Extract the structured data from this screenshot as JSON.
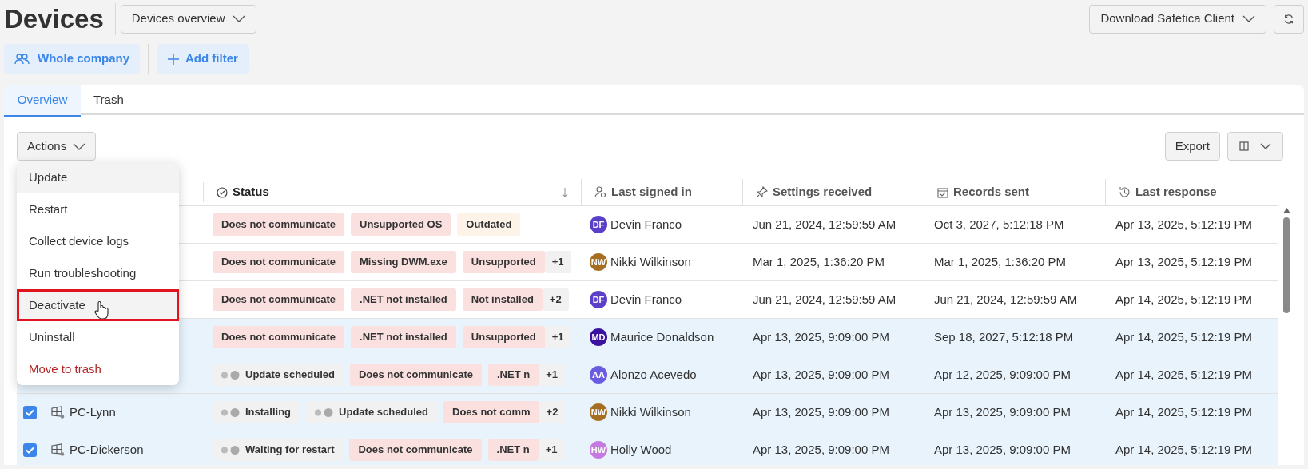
{
  "header": {
    "title": "Devices",
    "view_select": "Devices overview",
    "download_button": "Download Safetica Client"
  },
  "filters": {
    "scope": "Whole company",
    "add_filter": "Add filter"
  },
  "tabs": [
    {
      "label": "Overview",
      "selected": true
    },
    {
      "label": "Trash",
      "selected": false
    }
  ],
  "toolbar": {
    "actions": "Actions",
    "export": "Export"
  },
  "actions_menu": [
    {
      "label": "Update",
      "kind": "normal",
      "hovered": true,
      "outlined": false
    },
    {
      "label": "Restart",
      "kind": "normal",
      "hovered": false,
      "outlined": false
    },
    {
      "label": "Collect device logs",
      "kind": "normal",
      "hovered": false,
      "outlined": false
    },
    {
      "label": "Run troubleshooting",
      "kind": "normal",
      "hovered": false,
      "outlined": false
    },
    {
      "label": "Deactivate",
      "kind": "normal",
      "hovered": true,
      "outlined": true
    },
    {
      "label": "Uninstall",
      "kind": "normal",
      "hovered": false,
      "outlined": false
    },
    {
      "label": "Move to trash",
      "kind": "danger",
      "hovered": false,
      "outlined": false
    }
  ],
  "table": {
    "columns": [
      "Status",
      "Last signed in",
      "Settings received",
      "Records sent",
      "Last response"
    ],
    "rows": [
      {
        "selected": false,
        "status": [
          {
            "label": "Does not communicate",
            "kind": "error"
          },
          {
            "label": "Unsupported OS",
            "kind": "error"
          },
          {
            "label": "Outdated",
            "kind": "warning"
          }
        ],
        "user": {
          "initials": "DF",
          "name": "Devin Franco",
          "color": "#5a3fc8"
        },
        "settings_received": "Jun 21, 2024, 12:59:59 AM",
        "records_sent": "Oct 3, 2027, 5:12:18 PM",
        "last_response": "Apr 13, 2025, 5:12:19 PM"
      },
      {
        "selected": false,
        "status": [
          {
            "label": "Does not communicate",
            "kind": "error"
          },
          {
            "label": "Missing DWM.exe",
            "kind": "error"
          },
          {
            "label": "Unsupported",
            "kind": "error"
          }
        ],
        "more": "+1",
        "user": {
          "initials": "NW",
          "name": "Nikki Wilkinson",
          "color": "#a66e22"
        },
        "settings_received": "Mar 1, 2025, 1:36:20 PM",
        "records_sent": "Mar 1, 2025, 1:36:20 PM",
        "last_response": "Apr 13, 2025, 5:12:19 PM"
      },
      {
        "selected": false,
        "status": [
          {
            "label": "Does not communicate",
            "kind": "error"
          },
          {
            "label": ".NET not installed",
            "kind": "error"
          },
          {
            "label": "Not installed",
            "kind": "error"
          }
        ],
        "more": "+2",
        "user": {
          "initials": "DF",
          "name": "Devin Franco",
          "color": "#5a3fc8"
        },
        "settings_received": "Jun 21, 2024, 12:59:59 AM",
        "records_sent": "Jun 21, 2024, 12:59:59 AM",
        "last_response": "Apr 14, 2025, 5:12:19 PM"
      },
      {
        "selected": true,
        "status": [
          {
            "label": "Does not communicate",
            "kind": "error"
          },
          {
            "label": ".NET not installed",
            "kind": "error"
          },
          {
            "label": "Unsupported",
            "kind": "error"
          }
        ],
        "more": "+1",
        "user": {
          "initials": "MD",
          "name": "Maurice Donaldson",
          "color": "#3b12a0"
        },
        "settings_received": "Apr 13, 2025, 9:09:00 PM",
        "records_sent": "Sep 18, 2027, 5:12:18 PM",
        "last_response": "Apr 14, 2025, 5:12:19 PM"
      },
      {
        "selected": true,
        "status": [
          {
            "label": "Update scheduled",
            "kind": "progress"
          },
          {
            "label": "Does not communicate",
            "kind": "error"
          },
          {
            "label": ".NET n",
            "kind": "error"
          }
        ],
        "more": "+1",
        "user": {
          "initials": "AA",
          "name": "Alonzo Acevedo",
          "color": "#6a5be0"
        },
        "settings_received": "Apr 13, 2025, 9:09:00 PM",
        "records_sent": "Apr 12, 2025, 9:09:00 PM",
        "last_response": "Apr 14, 2025, 5:12:19 PM"
      },
      {
        "selected": true,
        "checked": true,
        "device": "PC-Lynn",
        "status": [
          {
            "label": "Installing",
            "kind": "progress"
          },
          {
            "label": "Update scheduled",
            "kind": "progress"
          },
          {
            "label": "Does not comm",
            "kind": "error"
          }
        ],
        "more": "+2",
        "user": {
          "initials": "NW",
          "name": "Nikki Wilkinson",
          "color": "#a66e22"
        },
        "settings_received": "Apr 13, 2025, 9:09:00 PM",
        "records_sent": "Apr 13, 2025, 9:09:00 PM",
        "last_response": "Apr 14, 2025, 5:12:19 PM"
      },
      {
        "selected": true,
        "checked": true,
        "device": "PC-Dickerson",
        "status": [
          {
            "label": "Waiting for restart",
            "kind": "progress"
          },
          {
            "label": "Does not communicate",
            "kind": "error"
          },
          {
            "label": ".NET n",
            "kind": "error"
          }
        ],
        "more": "+1",
        "user": {
          "initials": "HW",
          "name": "Holly Wood",
          "color": "#c47ae0"
        },
        "settings_received": "Apr 13, 2025, 9:09:00 PM",
        "records_sent": "Apr 13, 2025, 9:09:00 PM",
        "last_response": "Apr 14, 2025, 5:12:19 PM"
      }
    ]
  }
}
